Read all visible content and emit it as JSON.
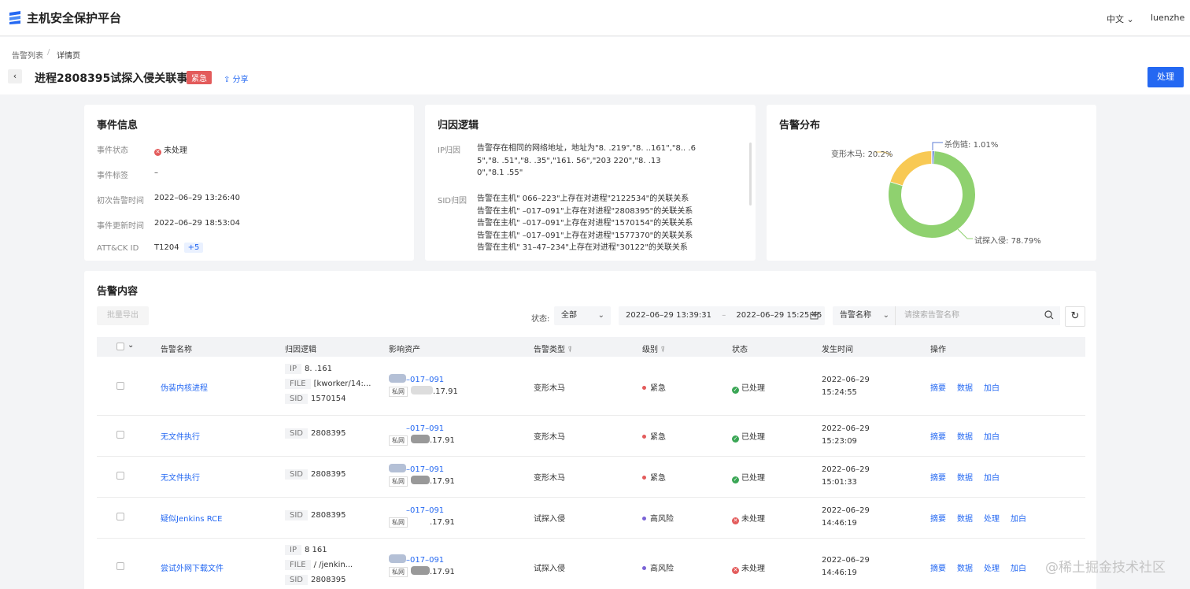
{
  "app": {
    "title": "主机安全保护平台",
    "lang": "中文",
    "user": "luenzhe"
  },
  "breadcrumb": {
    "parent": "告警列表",
    "separator": "/",
    "current": "详情页"
  },
  "page": {
    "title": "进程2808395试探入侵关联事件",
    "badge": "紧急",
    "share": "分享",
    "process_button": "处理"
  },
  "event_info": {
    "title": "事件信息",
    "fields": [
      {
        "label": "事件状态",
        "value": "未处理"
      },
      {
        "label": "事件标签",
        "value": "–"
      },
      {
        "label": "初次告警时间",
        "value": "2022–06–29 13:26:40"
      },
      {
        "label": "事件更新时间",
        "value": "2022–06–29 18:53:04"
      },
      {
        "label": "ATT&CK ID",
        "value": "T1204",
        "extra": "+5"
      }
    ]
  },
  "attribution": {
    "title": "归因逻辑",
    "ip_label": "IP归因",
    "ip_lines": [
      "告警存在相同的网络地址，地址为\"8.            .219\",\"8.            ..161\",\"8..            .6",
      "5\",\"8.            .51\",\"8.            .35\",\"161.            56\",\"203            220\",\"8.            .13",
      "0\",\"8.1            .55\""
    ],
    "sid_label": "SID归因",
    "sid_lines": [
      "告警在主机\"            066–223\"上存在对进程\"2122534\"的关联关系",
      "告警在主机\"            –017–091\"上存在对进程\"2808395\"的关联关系",
      "告警在主机\"            –017–091\"上存在对进程\"1570154\"的关联关系",
      "告警在主机\"            –017–091\"上存在对进程\"1577370\"的关联关系",
      "告警在主机\"            31–47–234\"上存在对进程\"30122\"的关联关系"
    ]
  },
  "distribution": {
    "title": "告警分布",
    "slices": [
      {
        "label": "试探入侵",
        "percent_text": "78.79%",
        "value": 78.79,
        "color": "#8fd16f"
      },
      {
        "label": "变形木马",
        "percent_text": "20.2%",
        "value": 20.2,
        "color": "#f8c954"
      },
      {
        "label": "杀伤链",
        "percent_text": "1.01%",
        "value": 1.01,
        "color": "#5b7bd6"
      }
    ]
  },
  "alerts": {
    "title": "告警内容",
    "export_button": "批量导出",
    "status_filter_label": "状态:",
    "status_filter_value": "全部",
    "date_start": "2022–06–29 13:39:31",
    "date_sep": "–",
    "date_end": "2022–06–29 15:25:45",
    "search_field": "告警名称",
    "search_placeholder": "请搜索告警名称",
    "columns": [
      "告警名称",
      "归因逻辑",
      "影响资产",
      "告警类型",
      "级别",
      "状态",
      "发生时间",
      "操作"
    ],
    "rows": [
      {
        "name": "伪装内核进程",
        "logic": [
          {
            "tag": "IP",
            "value": "8.            .161"
          },
          {
            "tag": "FILE",
            "value": "[kworker/14:..."
          },
          {
            "tag": "SID",
            "value": "1570154"
          }
        ],
        "asset_name": "–017–091",
        "asset_net": "私网",
        "asset_ip": ".17.91",
        "type": "变形木马",
        "level": "紧急",
        "level_color": "#e35b5b",
        "status": "已处理",
        "status_kind": "done",
        "date": "2022–06–29",
        "time": "15:24:55",
        "ops": [
          "摘要",
          "数据",
          "加白"
        ]
      },
      {
        "name": "无文件执行",
        "logic": [
          {
            "tag": "SID",
            "value": "2808395"
          }
        ],
        "asset_name": "–017–091",
        "asset_net": "私网",
        "asset_ip": ".17.91",
        "type": "变形木马",
        "level": "紧急",
        "level_color": "#e35b5b",
        "status": "已处理",
        "status_kind": "done",
        "date": "2022–06–29",
        "time": "15:23:09",
        "ops": [
          "摘要",
          "数据",
          "加白"
        ]
      },
      {
        "name": "无文件执行",
        "logic": [
          {
            "tag": "SID",
            "value": "2808395"
          }
        ],
        "asset_name": "–017–091",
        "asset_net": "私网",
        "asset_ip": ".17.91",
        "type": "变形木马",
        "level": "紧急",
        "level_color": "#e35b5b",
        "status": "已处理",
        "status_kind": "done",
        "date": "2022–06–29",
        "time": "15:01:33",
        "ops": [
          "摘要",
          "数据",
          "加白"
        ]
      },
      {
        "name": "疑似Jenkins RCE",
        "logic": [
          {
            "tag": "SID",
            "value": "2808395"
          }
        ],
        "asset_name": "–017–091",
        "asset_net": "私网",
        "asset_ip": ".17.91",
        "type": "试探入侵",
        "level": "高风险",
        "level_color": "#7a63d6",
        "status": "未处理",
        "status_kind": "todo",
        "date": "2022–06–29",
        "time": "14:46:19",
        "ops": [
          "摘要",
          "数据",
          "处理",
          "加白"
        ]
      },
      {
        "name": "尝试外网下载文件",
        "logic": [
          {
            "tag": "IP",
            "value": "8            161"
          },
          {
            "tag": "FILE",
            "value": "/            /jenkin..."
          },
          {
            "tag": "SID",
            "value": "2808395"
          }
        ],
        "asset_name": "–017–091",
        "asset_net": "私网",
        "asset_ip": ".17.91",
        "type": "试探入侵",
        "level": "高风险",
        "level_color": "#7a63d6",
        "status": "未处理",
        "status_kind": "todo",
        "date": "2022–06–29",
        "time": "14:46:19",
        "ops": [
          "摘要",
          "数据",
          "处理",
          "加白"
        ]
      }
    ]
  },
  "watermark": "@稀土掘金技术社区"
}
